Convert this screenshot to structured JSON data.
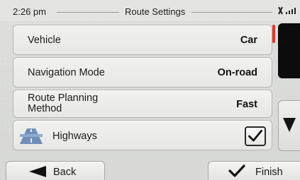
{
  "status_bar": {
    "time": "2:26 pm",
    "title": "Route Settings",
    "gps_icon": "gps-signal-icon"
  },
  "settings": [
    {
      "label": "Vehicle",
      "value": "Car"
    },
    {
      "label": "Navigation Mode",
      "value": "On-road"
    },
    {
      "label_line1": "Route Planning",
      "label_line2": "Method",
      "value": "Fast"
    },
    {
      "label": "Highways",
      "icon": "highway-icon",
      "checked": true
    }
  ],
  "scroll": {
    "up_icon": "scroll-up-icon",
    "down_icon": "scroll-down-arrow-icon"
  },
  "footer": {
    "back_label": "Back",
    "finish_label": "Finish"
  },
  "colors": {
    "background": "#dfe0dd",
    "accent": "#e0392e",
    "text": "#151515"
  }
}
